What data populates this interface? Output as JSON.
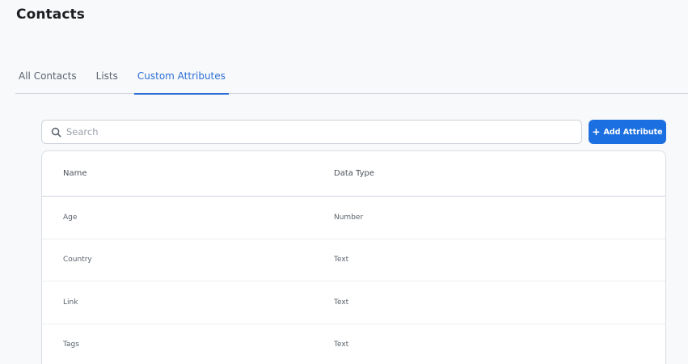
{
  "page": {
    "title": "Contacts"
  },
  "tabs": [
    {
      "label": "All Contacts",
      "active": false
    },
    {
      "label": "Lists",
      "active": false
    },
    {
      "label": "Custom Attributes",
      "active": true
    }
  ],
  "search": {
    "placeholder": "Search",
    "value": ""
  },
  "toolbar": {
    "add_label": "Add Attribute",
    "add_icon": "+"
  },
  "table": {
    "columns": [
      "Name",
      "Data Type"
    ],
    "rows": [
      {
        "name": "Age",
        "type": "Number"
      },
      {
        "name": "Country",
        "type": "Text"
      },
      {
        "name": "Link",
        "type": "Text"
      },
      {
        "name": "Tags",
        "type": "Text"
      }
    ]
  },
  "colors": {
    "accent": "#2a6ed6",
    "button": "#1b6fe0",
    "background": "#f8f9fb"
  },
  "icons": {
    "search": "search-icon",
    "add": "plus-icon"
  }
}
